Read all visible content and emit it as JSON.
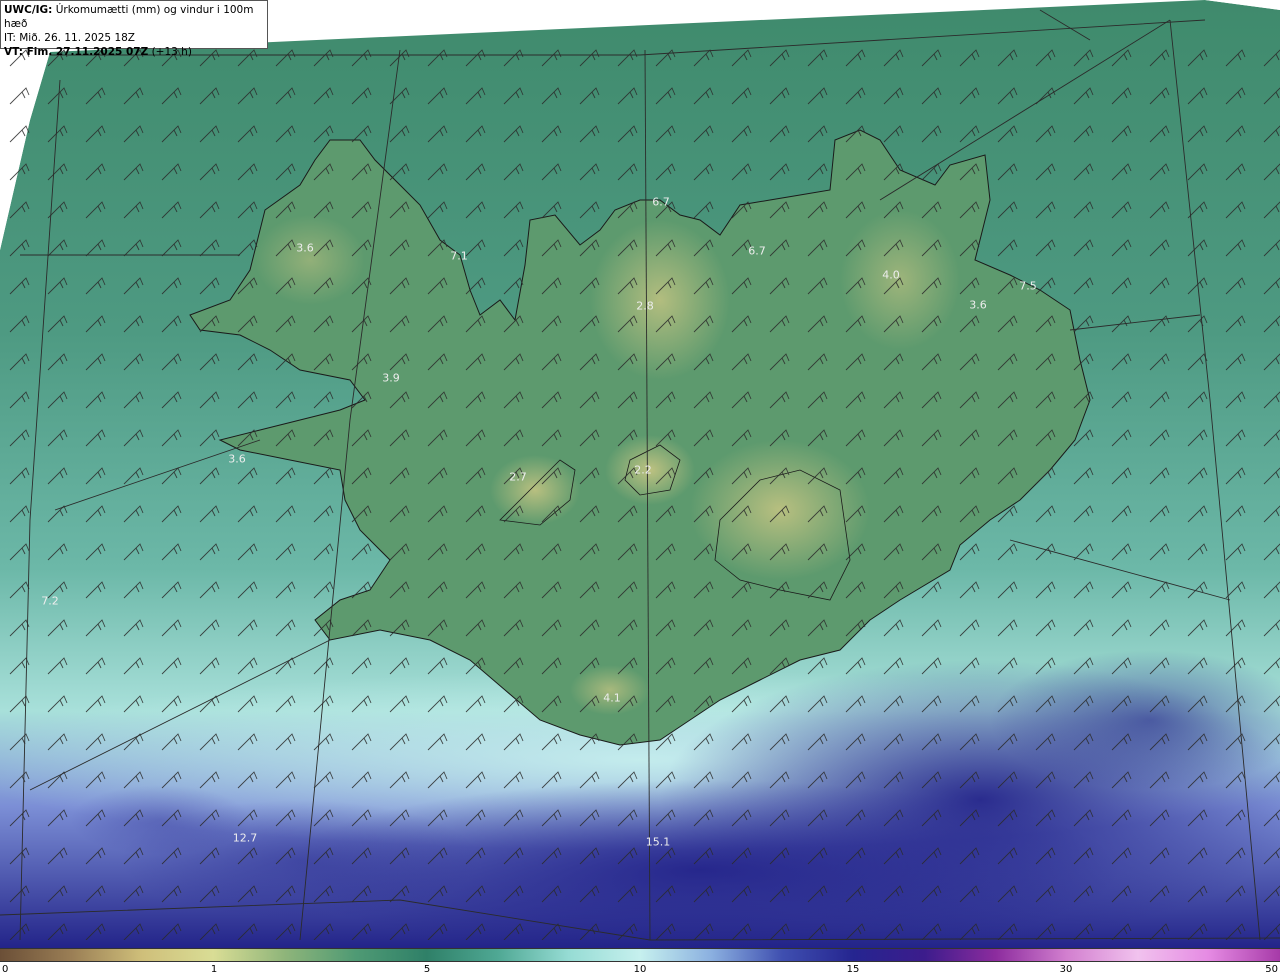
{
  "header": {
    "model": "UWC/IG:",
    "product": "Úrkomumætti (mm) og vindur i 100m hæð",
    "init_time": "IT: Mið. 26. 11. 2025 18Z",
    "valid_prefix": "VT: Fim. 27.11.2025 07Z",
    "lead_time": "(+13 h)"
  },
  "map": {
    "region": "Iceland",
    "colors": {
      "ocean_north": "#3f8a6c",
      "ocean_west": "#4e9a82",
      "land_low": "#5f9d70",
      "land_high": "#b9c07e",
      "ocean_south_light": "#9ad7cf",
      "heavy_precip": "#23208a",
      "grid_line": "#2b2b2b"
    },
    "point_values": [
      {
        "value": "3.6",
        "name": "westfjords-north"
      },
      {
        "value": "7.1",
        "name": "westfjords-east"
      },
      {
        "value": "6.7",
        "name": "north-coast-a"
      },
      {
        "value": "6.7",
        "name": "north-coast-b"
      },
      {
        "value": "4.0",
        "name": "northeast"
      },
      {
        "value": "3.6",
        "name": "east"
      },
      {
        "value": "7.5",
        "name": "east-coast"
      },
      {
        "value": "2.8",
        "name": "north-central"
      },
      {
        "value": "3.9",
        "name": "west"
      },
      {
        "value": "3.6",
        "name": "snaefellsnes"
      },
      {
        "value": "2.7",
        "name": "langjokull"
      },
      {
        "value": "2.2",
        "name": "hofsjokull"
      },
      {
        "value": "7.2",
        "name": "west-ocean"
      },
      {
        "value": "4.1",
        "name": "myrdalsjokull"
      },
      {
        "value": "12.7",
        "name": "southwest-ocean"
      },
      {
        "value": "15.1",
        "name": "south-ocean"
      }
    ]
  },
  "legend": {
    "ticks": [
      "0",
      "1",
      "5",
      "10",
      "15",
      "30",
      "50"
    ],
    "colors": [
      "#6b4f37",
      "#9a7e55",
      "#cfbf7a",
      "#d9dd95",
      "#8fb57a",
      "#4f9a74",
      "#2f8068",
      "#4fa894",
      "#96dcd4",
      "#c6f0ee",
      "#8bb0e0",
      "#3f4fb0",
      "#252590",
      "#3c1c8c",
      "#8c2c9e",
      "#d27fcf",
      "#f1c2ee",
      "#e58ae3",
      "#a63aa8"
    ]
  }
}
